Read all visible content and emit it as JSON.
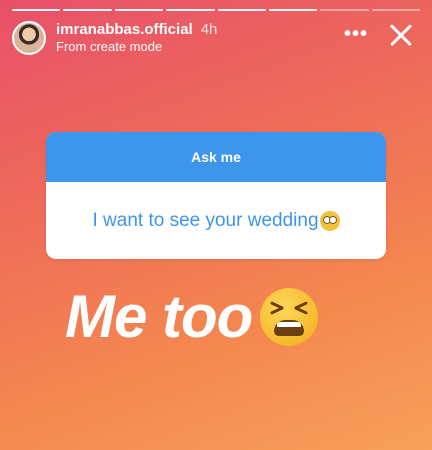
{
  "story": {
    "username": "imranabbas.official",
    "time": "4h",
    "subtitle": "From create mode",
    "more_label": "•••",
    "segments_total": 8,
    "segments_done": 6
  },
  "question_card": {
    "header": "Ask me",
    "answer": "I want to see your wedding",
    "answer_emoji": "rolling-eyes-emoji",
    "accent": "#3d95ec"
  },
  "caption": {
    "text": "Me too",
    "emoji": "tired-face-emoji"
  }
}
